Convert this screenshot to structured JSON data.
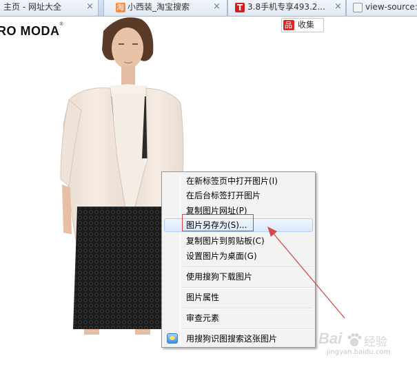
{
  "tabs": [
    {
      "title": "主页 - 网址大全",
      "active": false
    },
    {
      "title": "小西装_淘宝搜索",
      "active": false
    },
    {
      "title": "3.8手机专享493.2...",
      "active": false
    },
    {
      "title": "view-source:",
      "active": false
    }
  ],
  "page": {
    "brand": "RO MODA",
    "brand_mark": "®",
    "favorite_label": "收集",
    "product_image_label": "product-photo"
  },
  "context_menu": {
    "items": [
      {
        "label": "在新标签页中打开图片(I)"
      },
      {
        "label": "在后台标签打开图片"
      },
      {
        "label": "复制图片网址(P)"
      },
      {
        "label": "图片另存为(S)...",
        "highlighted": true
      },
      {
        "label": "复制图片到剪贴板(C)"
      },
      {
        "label": "设置图片为桌面(G)"
      },
      {
        "label": "使用搜狗下载图片"
      },
      {
        "label": "图片属性"
      },
      {
        "label": "审查元素"
      },
      {
        "label": "用搜狗识图搜索这张图片",
        "icon": "sogou-image-search-icon"
      }
    ]
  },
  "annotation": {
    "box_color": "#e03c3c",
    "arrow_color": "#d24b4b"
  },
  "watermark": {
    "logo": "Bai",
    "logo_tail": "经验",
    "url": "jingyan.baidu.com"
  },
  "colors": {
    "menu_bg": "#f3f3f3",
    "menu_highlight": "#dbeafb",
    "jacket": "#f2e6dc",
    "skirt": "#1e1e1e"
  }
}
